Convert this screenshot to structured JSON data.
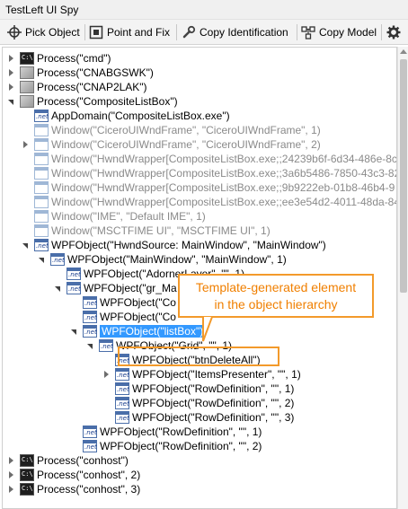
{
  "window": {
    "title": "TestLeft UI Spy"
  },
  "toolbar": {
    "pick_object": "Pick Object",
    "point_fix": "Point and Fix",
    "copy_identification": "Copy Identification",
    "copy_model": "Copy Model"
  },
  "callout": {
    "line1": "Template-generated element",
    "line2": "in the object hierarchy"
  },
  "tree": [
    {
      "label": "Process(\"cmd\")"
    },
    {
      "label": "Process(\"CNABGSWK\")"
    },
    {
      "label": "Process(\"CNAP2LAK\")"
    },
    {
      "label": "Process(\"CompositeListBox\")"
    },
    {
      "label": "AppDomain(\"CompositeListBox.exe\")"
    },
    {
      "label": "Window(\"CiceroUIWndFrame\", \"CiceroUIWndFrame\", 1)"
    },
    {
      "label": "Window(\"CiceroUIWndFrame\", \"CiceroUIWndFrame\", 2)"
    },
    {
      "label": "Window(\"HwndWrapper[CompositeListBox.exe;;24239b6f-6d34-486e-8c"
    },
    {
      "label": "Window(\"HwndWrapper[CompositeListBox.exe;;3a6b5486-7850-43c3-82"
    },
    {
      "label": "Window(\"HwndWrapper[CompositeListBox.exe;;9b9222eb-01b8-46b4-9"
    },
    {
      "label": "Window(\"HwndWrapper[CompositeListBox.exe;;ee3e54d2-4011-48da-84"
    },
    {
      "label": "Window(\"IME\", \"Default IME\", 1)"
    },
    {
      "label": "Window(\"MSCTFIME UI\", \"MSCTFIME UI\", 1)"
    },
    {
      "label": "WPFObject(\"HwndSource: MainWindow\", \"MainWindow\")"
    },
    {
      "label": "WPFObject(\"MainWindow\", \"MainWindow\", 1)"
    },
    {
      "label": "WPFObject(\"AdornerLayer\", \"\", 1)"
    },
    {
      "label": "WPFObject(\"gr_Ma"
    },
    {
      "label": "WPFObject(\"Co"
    },
    {
      "label": "WPFObject(\"Co"
    },
    {
      "label": "WPFObject(\"listBox\")"
    },
    {
      "label": "WPFObject(\"Grid\", \"\", 1)"
    },
    {
      "label": "WPFObject(\"btnDeleteAll\")"
    },
    {
      "label": "WPFObject(\"ItemsPresenter\", \"\", 1)"
    },
    {
      "label": "WPFObject(\"RowDefinition\", \"\", 1)"
    },
    {
      "label": "WPFObject(\"RowDefinition\", \"\", 2)"
    },
    {
      "label": "WPFObject(\"RowDefinition\", \"\", 3)"
    },
    {
      "label": "WPFObject(\"RowDefinition\", \"\", 1)"
    },
    {
      "label": "WPFObject(\"RowDefinition\", \"\", 2)"
    },
    {
      "label": "Process(\"conhost\")"
    },
    {
      "label": "Process(\"conhost\", 2)"
    },
    {
      "label": "Process(\"conhost\", 3)"
    }
  ]
}
